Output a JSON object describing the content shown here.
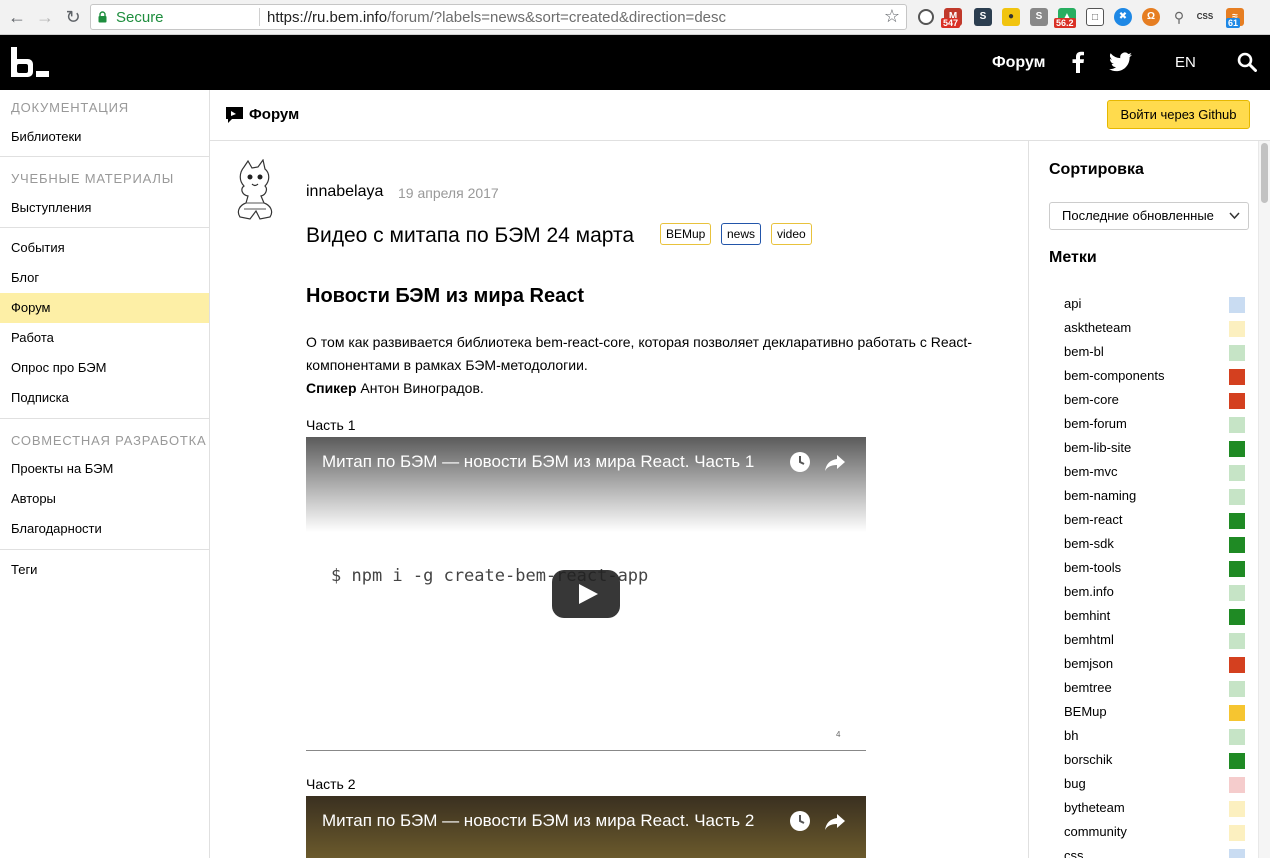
{
  "browser": {
    "secure_label": "Secure",
    "url_host": "https://ru.bem.info",
    "url_path": "/forum/?labels=news&sort=created&direction=desc",
    "ext_badges": [
      "547",
      "56.2",
      "CSS",
      "61"
    ]
  },
  "header": {
    "forum_link": "Форум",
    "lang": "EN"
  },
  "sidebar": {
    "sections": [
      {
        "title": "Документация",
        "items": [
          "Библиотеки"
        ]
      },
      {
        "title": "Учебные материалы",
        "items": [
          "Выступления"
        ]
      },
      {
        "title": "",
        "items": [
          "События",
          "Блог",
          "Форум",
          "Работа",
          "Опрос про БЭМ",
          "Подписка"
        ]
      },
      {
        "title": "Совместная разработка",
        "items": [
          "Проекты на БЭМ",
          "Авторы",
          "Благодарности"
        ]
      },
      {
        "title": "",
        "items": [
          "Теги"
        ]
      }
    ],
    "active": "Форум"
  },
  "forum_bar": {
    "title": "Форум",
    "login_button": "Войти через Github"
  },
  "post": {
    "author": "innabelaya",
    "date": "19 апреля 2017",
    "title": "Видео с митапа по БЭМ 24 марта",
    "tags": [
      {
        "label": "BEMup",
        "color": "#e8c23c"
      },
      {
        "label": "news",
        "color": "#2255aa"
      },
      {
        "label": "video",
        "color": "#e8c23c"
      }
    ],
    "heading": "Новости БЭМ из мира React",
    "paragraph": "О том как развивается библиотека bem-react-core, которая позволяет декларативно работать с React-компонентами в рамках БЭМ-методологии.",
    "speaker_label": "Спикер",
    "speaker_name": "Антон Виноградов.",
    "part1_label": "Часть 1",
    "part2_label": "Часть 2",
    "video1_title": "Митап по БЭМ — новости БЭМ из мира React. Часть 1",
    "video1_code": "$ npm i -g create-bem-react-app",
    "video1_page": "4",
    "video2_title": "Митап по БЭМ — новости БЭМ из мира React. Часть 2"
  },
  "right_panel": {
    "sort_heading": "Сортировка",
    "sort_value": "Последние обновленные",
    "labels_heading": "Метки",
    "labels": [
      {
        "name": "api",
        "color": "#c9dcf2"
      },
      {
        "name": "asktheteam",
        "color": "#fcf0c0"
      },
      {
        "name": "bem-bl",
        "color": "#c6e4c6"
      },
      {
        "name": "bem-components",
        "color": "#d4401f"
      },
      {
        "name": "bem-core",
        "color": "#d4401f"
      },
      {
        "name": "bem-forum",
        "color": "#c6e4c6"
      },
      {
        "name": "bem-lib-site",
        "color": "#1f8a24"
      },
      {
        "name": "bem-mvc",
        "color": "#c6e4c6"
      },
      {
        "name": "bem-naming",
        "color": "#c6e4c6"
      },
      {
        "name": "bem-react",
        "color": "#1f8a24"
      },
      {
        "name": "bem-sdk",
        "color": "#1f8a24"
      },
      {
        "name": "bem-tools",
        "color": "#1f8a24"
      },
      {
        "name": "bem.info",
        "color": "#c6e4c6"
      },
      {
        "name": "bemhint",
        "color": "#1f8a24"
      },
      {
        "name": "bemhtml",
        "color": "#c6e4c6"
      },
      {
        "name": "bemjson",
        "color": "#d4401f"
      },
      {
        "name": "bemtree",
        "color": "#c6e4c6"
      },
      {
        "name": "BEMup",
        "color": "#f6c530"
      },
      {
        "name": "bh",
        "color": "#c6e4c6"
      },
      {
        "name": "borschik",
        "color": "#1f8a24"
      },
      {
        "name": "bug",
        "color": "#f5cccc"
      },
      {
        "name": "bytheteam",
        "color": "#fcf0c0"
      },
      {
        "name": "community",
        "color": "#fcf0c0"
      },
      {
        "name": "css",
        "color": "#c9dcf2"
      }
    ]
  }
}
